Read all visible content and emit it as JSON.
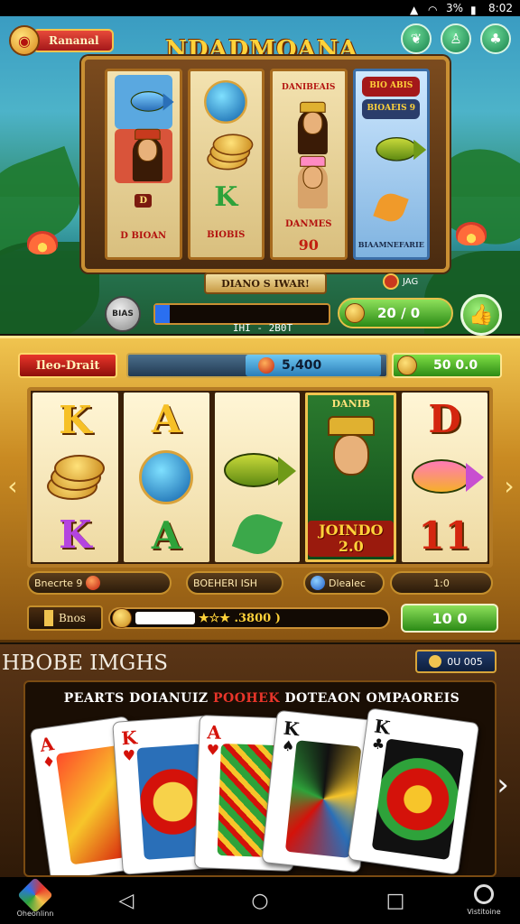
{
  "status_bar": {
    "battery": "3%",
    "time": "8:02"
  },
  "top": {
    "rank_label": "Rananal",
    "icons": [
      "leaf-icon",
      "person-icon",
      "tree-icon"
    ]
  },
  "upper_machine": {
    "title": "NDADMOANA",
    "reel1": {
      "banner": "D",
      "caption": "D BIOAN"
    },
    "reel2": {
      "letter": "K",
      "caption": "BIOBIS"
    },
    "reel3": {
      "top": "DANIBEAIS",
      "caption": "DANMES",
      "value": "90"
    },
    "reel4": {
      "top": "BIO ABIS",
      "caption": "BIOAEIS 9",
      "bottom": "BIAAMNEFARIE"
    },
    "caption": "DIANO S IWAR!",
    "mini": "JAG",
    "round_btn": "BIAS",
    "bar_caption": "IHI - 2B0T",
    "win": "20 / 0"
  },
  "main_machine": {
    "label": "Ileo-Drait",
    "balance": "5,400",
    "credit": "50 0.0",
    "reels": [
      {
        "top": "K",
        "mid": "coins",
        "bottom": "K"
      },
      {
        "top": "A",
        "mid": "orb",
        "bottom": "A"
      },
      {
        "top": "",
        "mid": "fish",
        "bottom": "plant"
      },
      {
        "top": "DANIB",
        "mid": "queen",
        "bottom": "JOINDO 2.0"
      },
      {
        "top": "D",
        "mid": "pink-fish",
        "bottom": "11"
      }
    ],
    "stats": {
      "s1": "Bnecrte 9",
      "s2": "BOEHERI ISH",
      "s3": "Dlealec",
      "s4": "1:0"
    },
    "bet_label": "Bnos",
    "progress_text": "★☆★ .3800 )",
    "progress_level": 0.22,
    "spin": "10 0"
  },
  "cards": {
    "title": "HBOBE IMGHS",
    "badge": "0U 005",
    "subtitle_a": "PEARTS DOIANUIZ ",
    "subtitle_b": "POOHEK",
    "subtitle_c": " DOTEAON OMPAOREIS",
    "items": [
      {
        "rank": "A",
        "suit": "♦",
        "color": "red"
      },
      {
        "rank": "K",
        "suit": "♥",
        "color": "red"
      },
      {
        "rank": "A",
        "suit": "♥",
        "color": "red"
      },
      {
        "rank": "K",
        "suit": "♠",
        "color": "black"
      },
      {
        "rank": "K",
        "suit": "♣",
        "color": "black"
      }
    ]
  },
  "nav": {
    "left_label": "Oheonlinn",
    "right_label": "Vistitoine"
  }
}
